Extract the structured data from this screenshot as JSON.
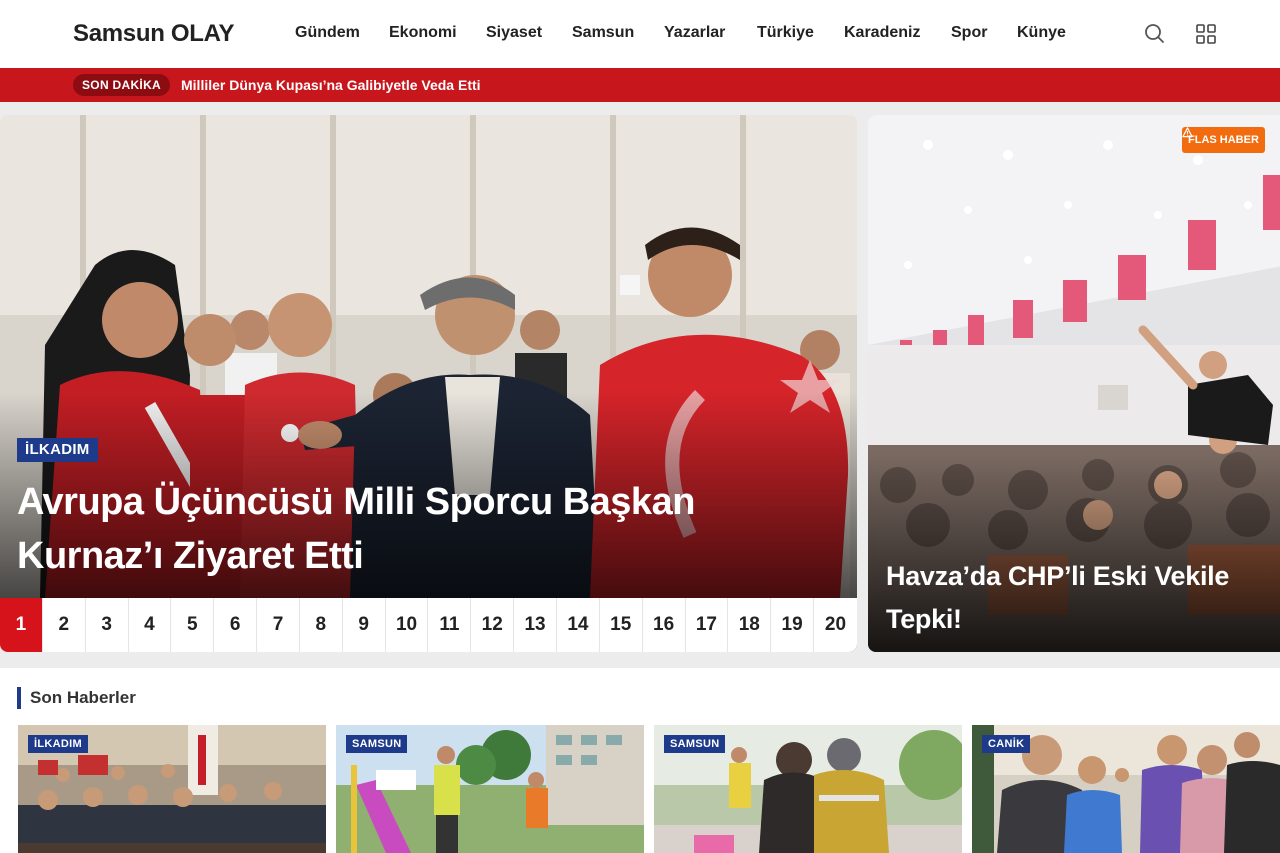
{
  "header": {
    "logo": "Samsun OLAY",
    "nav": [
      "Gündem",
      "Ekonomi",
      "Siyaset",
      "Samsun",
      "Yazarlar",
      "Türkiye",
      "Karadeniz",
      "Spor",
      "Künye"
    ],
    "icons": [
      "search-icon",
      "grid-menu-icon"
    ]
  },
  "breaking": {
    "label": "SON DAKİKA",
    "headline": "Milliler Dünya Kupası’na Galibiyetle Veda Etti"
  },
  "slider": {
    "category": "İLKADIM",
    "title": "Avrupa Üçüncüsü Milli Sporcu Başkan Kurnaz’ı Ziyaret Etti",
    "pages": [
      "1",
      "2",
      "3",
      "4",
      "5",
      "6",
      "7",
      "8",
      "9",
      "10",
      "11",
      "12",
      "13",
      "14",
      "15",
      "16",
      "17",
      "18",
      "19",
      "20"
    ],
    "active_page": "1"
  },
  "side_story": {
    "badge": "FLAS HABER",
    "title": "Havza’da CHP’li Eski Vekile Tepki!"
  },
  "latest": {
    "title": "Son Haberler",
    "cards": [
      {
        "category": "İLKADIM"
      },
      {
        "category": "SAMSUN"
      },
      {
        "category": "SAMSUN"
      },
      {
        "category": "CANİK"
      }
    ]
  },
  "colors": {
    "accent_red": "#c8161d",
    "category_blue": "#1e3a8a",
    "flash_orange": "#f26b0f"
  }
}
